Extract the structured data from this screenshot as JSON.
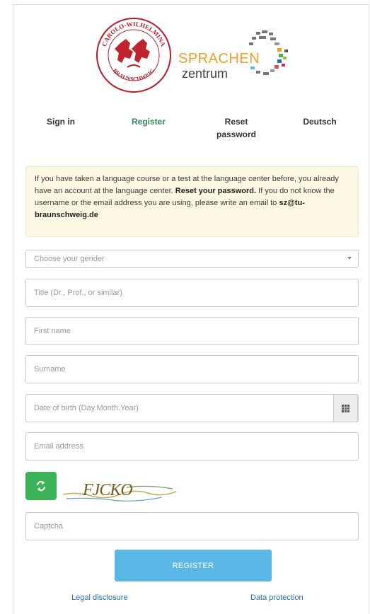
{
  "header": {
    "seal_text_top": "CAROLO-WILHELMINA",
    "seal_text_bottom": "BRAUNSCHWEIG",
    "sprachen_text": "SPRACHEN",
    "zentrum_text": "zentrum"
  },
  "tabs": [
    {
      "label": "Sign in",
      "active": false
    },
    {
      "label": "Register",
      "active": true
    },
    {
      "label": "Reset password",
      "active": false
    },
    {
      "label": "Deutsch",
      "active": false
    }
  ],
  "info": {
    "text_1": "If you have taken a language course or a test at the language center before, you already have an account at the language center. ",
    "reset_link": "Reset your password.",
    "text_2": " If you do not know the username or the email address you are using, please write an email to ",
    "email": "sz@tu-braunschweig.de"
  },
  "form": {
    "gender_placeholder": "Choose your gender",
    "title_placeholder": "Title (Dr., Prof., or similar)",
    "first_name_placeholder": "First name",
    "surname_placeholder": "Surname",
    "dob_placeholder": "Date of birth (Day.Month.Year)",
    "email_placeholder": "Email address",
    "captcha_image_text": "FJCKO",
    "captcha_placeholder": "Captcha",
    "register_label": "REGISTER"
  },
  "footer": {
    "legal_label": "Legal disclosure",
    "privacy_label": "Data protection"
  },
  "colors": {
    "active_tab": "#2e8b57",
    "info_bg": "#fcf8e3",
    "register_button": "#5bb8e6",
    "refresh_button": "#3cb357",
    "link": "#2a6db0",
    "seal_red": "#b41e2a",
    "sprachen_orange": "#f0a025"
  }
}
